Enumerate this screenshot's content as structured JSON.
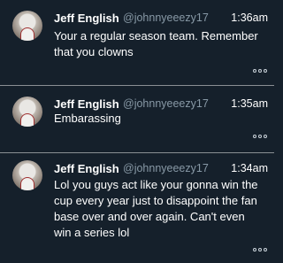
{
  "tweets": [
    {
      "name": "Jeff English",
      "handle": "@johnnyeeezy17",
      "time": "1:36am",
      "text": "Your a regular season team. Remember that you clowns"
    },
    {
      "name": "Jeff English",
      "handle": "@johnnyeeezy17",
      "time": "1:35am",
      "text": "Embarassing"
    },
    {
      "name": "Jeff English",
      "handle": "@johnnyeeezy17",
      "time": "1:34am",
      "text": "Lol you guys act like your gonna win the cup every year just to disappoint the fan base over and over again. Can't even win a series lol"
    }
  ],
  "icons": {
    "avatar": "profile-avatar",
    "more": "more-options-icon"
  },
  "colors": {
    "background": "#15202b",
    "primary_text": "#ffffff",
    "secondary_text": "#8899a6",
    "divider": "#8a8f94"
  }
}
